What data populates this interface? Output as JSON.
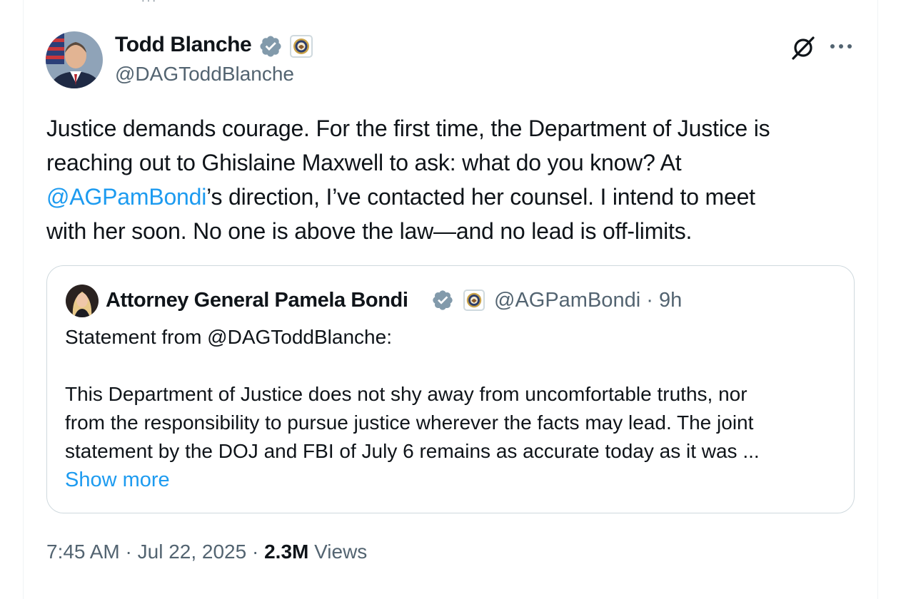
{
  "tweet": {
    "author": {
      "name": "Todd Blanche",
      "handle": "@DAGToddBlanche"
    },
    "text_before_mention": "Justice demands courage. For the first time, the Department of Justice is",
    "text_line2": "reaching out to Ghislaine Maxwell to ask: what do you know? At",
    "mention": "@AGPamBondi",
    "text_after_mention": "’s direction, I’ve contacted her counsel. I intend to meet",
    "text_line4": "with her soon. No one is above the law—and no lead is off-limits.",
    "time": "7:45 AM",
    "date": "Jul 22, 2025",
    "separator": "·",
    "views_count": "2.3M",
    "views_label": "Views"
  },
  "quote": {
    "author_name": "Attorney General Pamela Bondi",
    "handle": "@AGPamBondi",
    "age": "9h",
    "separator": "·",
    "lines": [
      "Statement from @DAGToddBlanche:",
      "",
      "This Department of Justice does not shy away from uncomfortable truths, nor",
      "from the responsibility to pursue justice wherever the facts may lead.  The joint",
      "statement by the DOJ and FBI of July 6 remains as accurate today as it was ..."
    ],
    "show_more": "Show more"
  },
  "icons": {
    "verified": "verified-badge-icon",
    "affiliation": "doj-seal-icon",
    "grok": "grok-icon",
    "more": "more-options-icon"
  },
  "colors": {
    "link": "#1d9bf0",
    "secondary_text": "#536471",
    "primary_text": "#0f1419",
    "border": "#cfd9de"
  }
}
